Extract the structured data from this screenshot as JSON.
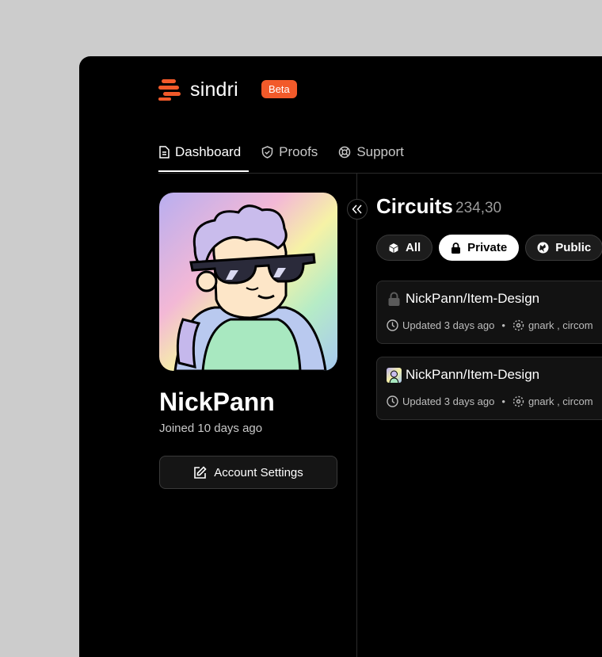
{
  "brand": {
    "name": "sindri",
    "badge": "Beta",
    "accent": "#f25a2a"
  },
  "tabs": [
    {
      "label": "Dashboard",
      "icon": "document-icon",
      "active": true
    },
    {
      "label": "Proofs",
      "icon": "shield-check-icon",
      "active": false
    },
    {
      "label": "Support",
      "icon": "lifebuoy-icon",
      "active": false
    }
  ],
  "profile": {
    "username": "NickPann",
    "joined": "Joined 10 days ago",
    "account_settings_label": "Account Settings"
  },
  "circuits": {
    "title": "Circuits",
    "count": "234,30",
    "filters": [
      {
        "label": "All",
        "icon": "cube-icon",
        "active": false
      },
      {
        "label": "Private",
        "icon": "lock-icon",
        "active": true
      },
      {
        "label": "Public",
        "icon": "globe-icon",
        "active": false
      }
    ],
    "items": [
      {
        "name": "NickPann/Item-Design",
        "icon": "lock-icon",
        "updated": "Updated 3 days ago",
        "frameworks": "gnark , circom"
      },
      {
        "name": "NickPann/Item-Design",
        "icon": "avatar-icon",
        "updated": "Updated 3 days ago",
        "frameworks": "gnark , circom"
      }
    ]
  }
}
